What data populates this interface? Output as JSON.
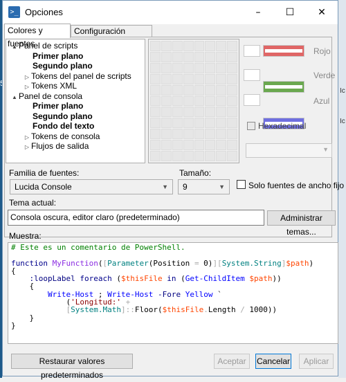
{
  "window": {
    "title": "Opciones",
    "app_icon": "powershell-icon",
    "controls": {
      "minimize": "–",
      "maximize": "☐",
      "close": "✕"
    }
  },
  "tabs": [
    {
      "label": "Colores y fuentes",
      "active": true
    },
    {
      "label": "Configuración general",
      "active": false
    }
  ],
  "tree": {
    "items": [
      {
        "label": "Panel de scripts",
        "expander": "▲",
        "bold": false,
        "indent": 0
      },
      {
        "label": "Primer plano",
        "expander": "",
        "bold": true,
        "indent": 2
      },
      {
        "label": "Segundo plano",
        "expander": "",
        "bold": true,
        "indent": 2
      },
      {
        "label": "Tokens del panel de scripts",
        "expander": "▷",
        "bold": false,
        "indent": 1
      },
      {
        "label": "Tokens XML",
        "expander": "▷",
        "bold": false,
        "indent": 1
      },
      {
        "label": "Panel de consola",
        "expander": "▲",
        "bold": false,
        "indent": 0
      },
      {
        "label": "Primer plano",
        "expander": "",
        "bold": true,
        "indent": 2
      },
      {
        "label": "Segundo plano",
        "expander": "",
        "bold": true,
        "indent": 2
      },
      {
        "label": "Fondo del texto",
        "expander": "",
        "bold": true,
        "indent": 2
      },
      {
        "label": "Tokens de consola",
        "expander": "▷",
        "bold": false,
        "indent": 1
      },
      {
        "label": "Flujos de salida",
        "expander": "▷",
        "bold": false,
        "indent": 1
      }
    ]
  },
  "color_editor": {
    "red_label": "Rojo",
    "green_label": "Verde",
    "blue_label": "Azul",
    "red_color": "#e06666",
    "green_color": "#6aa84f",
    "blue_color": "#6f6fe0",
    "hex_label": "Hexadecimal"
  },
  "font": {
    "family_label": "Familia de fuentes:",
    "family_value": "Lucida Console",
    "size_label": "Tamaño:",
    "size_value": "9",
    "fixed_width_label": "Solo fuentes de ancho fijo"
  },
  "theme": {
    "label": "Tema actual:",
    "value": "Consola oscura, editor claro (predeterminado)",
    "manage_button": "Administrar temas..."
  },
  "sample": {
    "label": "Muestra:",
    "lines": [
      [
        {
          "t": "# Este es un comentario de PowerShell.",
          "c": "c-comment"
        }
      ],
      [
        {
          "t": "",
          "c": ""
        }
      ],
      [
        {
          "t": "function ",
          "c": "c-kw"
        },
        {
          "t": "MyFunction",
          "c": "c-fn"
        },
        {
          "t": "(",
          "c": ""
        },
        {
          "t": "[",
          "c": "c-bracket"
        },
        {
          "t": "Parameter",
          "c": "c-type"
        },
        {
          "t": "(Position ",
          "c": ""
        },
        {
          "t": "=",
          "c": "c-op"
        },
        {
          "t": " 0)",
          "c": ""
        },
        {
          "t": "][",
          "c": "c-bracket"
        },
        {
          "t": "System.String",
          "c": "c-type"
        },
        {
          "t": "]",
          "c": "c-bracket"
        },
        {
          "t": "$path",
          "c": "c-var"
        },
        {
          "t": ")",
          "c": ""
        }
      ],
      [
        {
          "t": "{",
          "c": ""
        }
      ],
      [
        {
          "t": "    ",
          "c": ""
        },
        {
          "t": ":loopLabel ",
          "c": "c-param"
        },
        {
          "t": "foreach ",
          "c": "c-kw"
        },
        {
          "t": "(",
          "c": ""
        },
        {
          "t": "$thisFile ",
          "c": "c-var"
        },
        {
          "t": "in ",
          "c": "c-kw"
        },
        {
          "t": "(",
          "c": ""
        },
        {
          "t": "Get-ChildItem ",
          "c": "c-cmd"
        },
        {
          "t": "$path",
          "c": "c-var"
        },
        {
          "t": "))",
          "c": ""
        }
      ],
      [
        {
          "t": "    {",
          "c": ""
        }
      ],
      [
        {
          "t": "        ",
          "c": ""
        },
        {
          "t": "Write-Host ",
          "c": "c-cmd"
        },
        {
          "t": "; ",
          "c": ""
        },
        {
          "t": "Write-Host ",
          "c": "c-cmd"
        },
        {
          "t": "-Fore ",
          "c": "c-param"
        },
        {
          "t": "Yellow ",
          "c": "c-cmd"
        },
        {
          "t": "`",
          "c": ""
        }
      ],
      [
        {
          "t": "            (",
          "c": ""
        },
        {
          "t": "'Longitud:' ",
          "c": "c-str"
        },
        {
          "t": "+",
          "c": "c-op"
        }
      ],
      [
        {
          "t": "            ",
          "c": ""
        },
        {
          "t": "[",
          "c": "c-bracket"
        },
        {
          "t": "System.Math",
          "c": "c-type"
        },
        {
          "t": "]",
          "c": "c-bracket"
        },
        {
          "t": "::",
          "c": "c-op"
        },
        {
          "t": "Floor(",
          "c": ""
        },
        {
          "t": "$thisFile",
          "c": "c-var"
        },
        {
          "t": ".",
          "c": "c-op"
        },
        {
          "t": "Length ",
          "c": ""
        },
        {
          "t": "/",
          "c": "c-op"
        },
        {
          "t": " 1000))",
          "c": ""
        }
      ],
      [
        {
          "t": "    }",
          "c": ""
        }
      ],
      [
        {
          "t": "}",
          "c": ""
        }
      ]
    ]
  },
  "buttons": {
    "restore": "Restaurar valores predeterminados",
    "ok": "Aceptar",
    "cancel": "Cancelar",
    "apply": "Aplicar"
  },
  "background_marks": [
    "Ic",
    "Ic"
  ],
  "background_left_mark": "5"
}
